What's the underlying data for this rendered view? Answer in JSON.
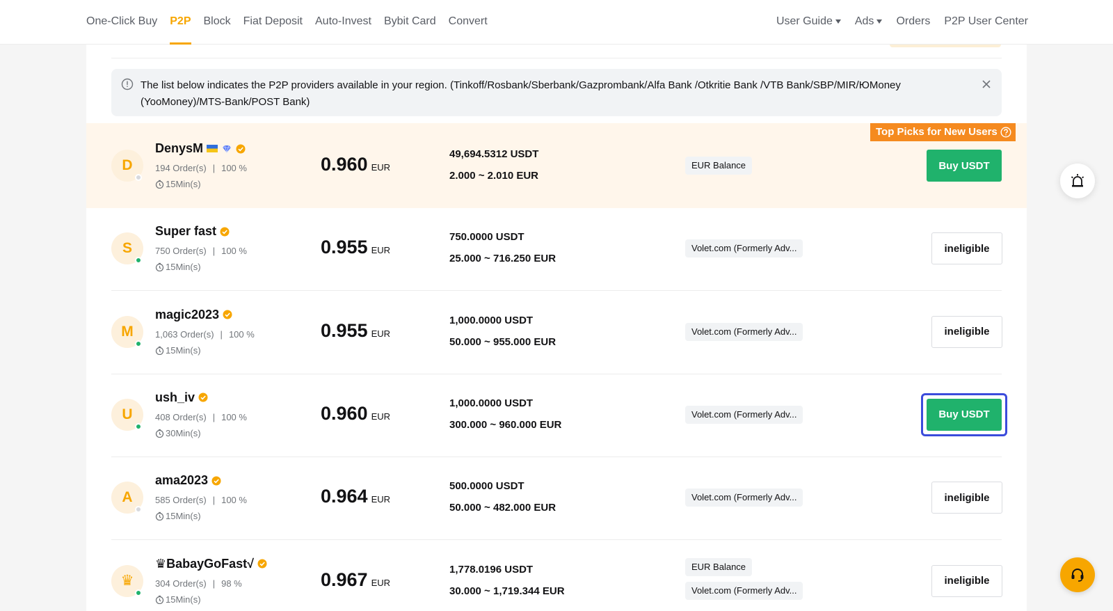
{
  "nav": {
    "left": [
      "One-Click Buy",
      "P2P",
      "Block",
      "Fiat Deposit",
      "Auto-Invest",
      "Bybit Card",
      "Convert"
    ],
    "active": "P2P",
    "right": [
      "User Guide",
      "Ads",
      "Orders",
      "P2P User Center"
    ]
  },
  "notice": {
    "line1": "The list below indicates the P2P providers available in your region. (Tinkoff/Rosbank/Sberbank/Gazprombank/Alfa Bank /Otkritie Bank /VTB Bank/SBP/MIR/ЮMoney",
    "line2": "(YooMoney)/MTS-Bank/POST Bank)"
  },
  "badge_top_picks": "Top Picks for New Users",
  "ads": [
    {
      "initial": "D",
      "nickname": "DenysM",
      "flag": true,
      "diamond": true,
      "online": false,
      "orders": "194 Order(s)",
      "completion": "100 %",
      "time": "15Min(s)",
      "price": "0.960",
      "currency": "EUR",
      "available": "49,694.5312 USDT",
      "limit": "2.000 ~ 2.010 EUR",
      "payments": [
        "EUR Balance"
      ],
      "action": "Buy USDT",
      "eligible": true,
      "highlight": true,
      "focused": false
    },
    {
      "initial": "S",
      "nickname": "Super fast",
      "flag": false,
      "diamond": false,
      "online": true,
      "orders": "750 Order(s)",
      "completion": "100 %",
      "time": "15Min(s)",
      "price": "0.955",
      "currency": "EUR",
      "available": "750.0000 USDT",
      "limit": "25.000 ~ 716.250 EUR",
      "payments": [
        "Volet.com (Formerly Adv..."
      ],
      "action": "ineligible",
      "eligible": false,
      "highlight": false,
      "focused": false
    },
    {
      "initial": "M",
      "nickname": "magic2023",
      "flag": false,
      "diamond": false,
      "online": true,
      "orders": "1,063 Order(s)",
      "completion": "100 %",
      "time": "15Min(s)",
      "price": "0.955",
      "currency": "EUR",
      "available": "1,000.0000 USDT",
      "limit": "50.000 ~ 955.000 EUR",
      "payments": [
        "Volet.com (Formerly Adv..."
      ],
      "action": "ineligible",
      "eligible": false,
      "highlight": false,
      "focused": false
    },
    {
      "initial": "U",
      "nickname": "ush_iv",
      "flag": false,
      "diamond": false,
      "online": true,
      "orders": "408 Order(s)",
      "completion": "100 %",
      "time": "30Min(s)",
      "price": "0.960",
      "currency": "EUR",
      "available": "1,000.0000 USDT",
      "limit": "300.000 ~ 960.000 EUR",
      "payments": [
        "Volet.com (Formerly Adv..."
      ],
      "action": "Buy USDT",
      "eligible": true,
      "highlight": false,
      "focused": true
    },
    {
      "initial": "A",
      "nickname": "ama2023",
      "flag": false,
      "diamond": false,
      "online": false,
      "orders": "585 Order(s)",
      "completion": "100 %",
      "time": "15Min(s)",
      "price": "0.964",
      "currency": "EUR",
      "available": "500.0000 USDT",
      "limit": "50.000 ~ 482.000 EUR",
      "payments": [
        "Volet.com (Formerly Adv..."
      ],
      "action": "ineligible",
      "eligible": false,
      "highlight": false,
      "focused": false
    },
    {
      "initial": "♛",
      "nickname": "♛BabayGoFast√",
      "flag": false,
      "diamond": false,
      "online": true,
      "orders": "304 Order(s)",
      "completion": "98 %",
      "time": "15Min(s)",
      "price": "0.967",
      "currency": "EUR",
      "available": "1,778.0196 USDT",
      "limit": "30.000 ~ 1,719.344 EUR",
      "payments": [
        "EUR Balance",
        "Volet.com (Formerly Adv..."
      ],
      "action": "ineligible",
      "eligible": false,
      "highlight": false,
      "focused": false
    }
  ],
  "colors": {
    "brand": "#f7a600",
    "buy": "#20b26c",
    "focus": "#3b4bdb",
    "top_picks": "#f58a1f"
  },
  "icons": {
    "alarm": "alarm-icon",
    "support": "headset-icon",
    "info": "info-icon",
    "close": "close-icon",
    "clock": "clock-icon",
    "verified": "verified-badge-icon",
    "diamond": "diamond-icon",
    "help": "help-icon"
  }
}
